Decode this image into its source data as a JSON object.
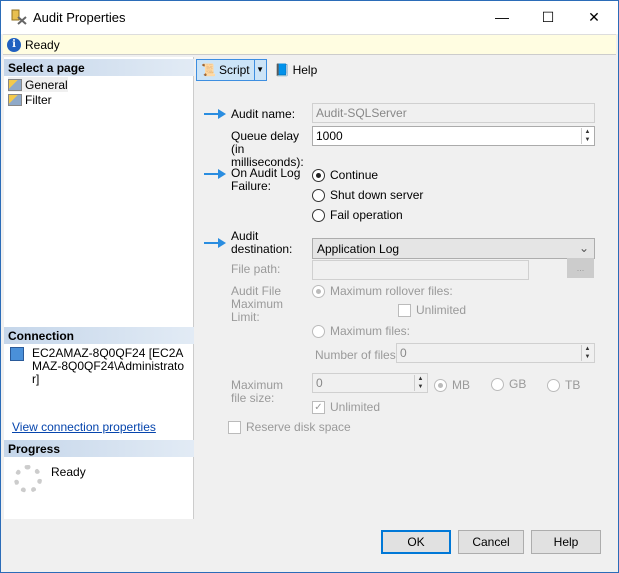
{
  "window": {
    "title": "Audit Properties",
    "minimize": "—",
    "maximize": "☐",
    "close": "✕"
  },
  "infobar": {
    "status": "Ready"
  },
  "left": {
    "select_page_header": "Select a page",
    "pages": [
      {
        "label": "General"
      },
      {
        "label": "Filter"
      }
    ],
    "connection_header": "Connection",
    "connection_text": "EC2AMAZ-8Q0QF24 [EC2AMAZ-8Q0QF24\\Administrator]",
    "view_connection_link": "View connection properties",
    "progress_header": "Progress",
    "progress_status": "Ready"
  },
  "toolbar": {
    "script": "Script",
    "help": "Help"
  },
  "form": {
    "audit_name_label": "Audit name:",
    "audit_name_value": "Audit-SQLServer",
    "queue_delay_label": "Queue delay (in milliseconds):",
    "queue_delay_value": "1000",
    "on_failure_label": "On Audit Log Failure:",
    "on_failure_options": [
      "Continue",
      "Shut down server",
      "Fail operation"
    ],
    "on_failure_selected": "Continue",
    "destination_label": "Audit destination:",
    "destination_value": "Application Log",
    "file_path_label": "File path:",
    "file_path_value": "",
    "browse_label": "...",
    "max_limit_label": "Audit File Maximum Limit:",
    "max_rollover_label": "Maximum rollover files:",
    "unlimited_label": "Unlimited",
    "max_files_label": "Maximum files:",
    "num_files_label": "Number of files:",
    "num_files_value": "0",
    "max_file_size_label": "Maximum file size:",
    "max_file_size_value": "0",
    "units": [
      "MB",
      "GB",
      "TB"
    ],
    "unit_selected": "MB",
    "size_unlimited_label": "Unlimited",
    "size_unlimited_checked": true,
    "reserve_disk_label": "Reserve disk space",
    "reserve_disk_checked": false
  },
  "buttons": {
    "ok": "OK",
    "cancel": "Cancel",
    "help": "Help"
  },
  "colors": {
    "accent": "#0078d7",
    "arrow": "#2a8de0",
    "infobar": "#fffde1"
  }
}
